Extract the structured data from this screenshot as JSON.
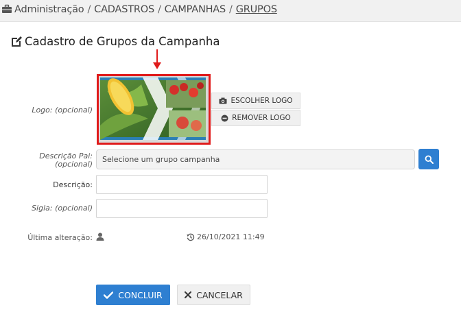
{
  "breadcrumb": {
    "items": [
      "Administração",
      "CADASTROS",
      "CAMPANHAS",
      "GRUPOS"
    ],
    "separator": "/"
  },
  "page": {
    "title": "Cadastro de Grupos da Campanha"
  },
  "form": {
    "logo_label": "Logo: (opcional)",
    "choose_logo_label": "ESCOLHER LOGO",
    "remove_logo_label": "REMOVER LOGO",
    "parent_label_line1": "Descrição Pai:",
    "parent_label_line2": "(opcional)",
    "parent_value": "Selecione um grupo campanha",
    "description_label": "Descrição:",
    "description_value": "",
    "acronym_label": "Sigla: (opcional)",
    "acronym_value": "",
    "last_change_label": "Última alteração:",
    "last_change_date": "26/10/2021 11:49"
  },
  "actions": {
    "confirm_label": "CONCLUIR",
    "cancel_label": "CANCELAR"
  },
  "icons": {
    "breadcrumb": "briefcase-icon",
    "title": "edit-icon",
    "choose_logo": "camera-icon",
    "remove_logo": "minus-circle-icon",
    "search": "search-icon",
    "user": "user-icon",
    "history": "history-icon",
    "confirm": "check-icon",
    "cancel": "close-icon"
  },
  "colors": {
    "primary": "#2e7fd1",
    "highlight": "#e01b1b",
    "topbar": "#f1f1f1"
  }
}
